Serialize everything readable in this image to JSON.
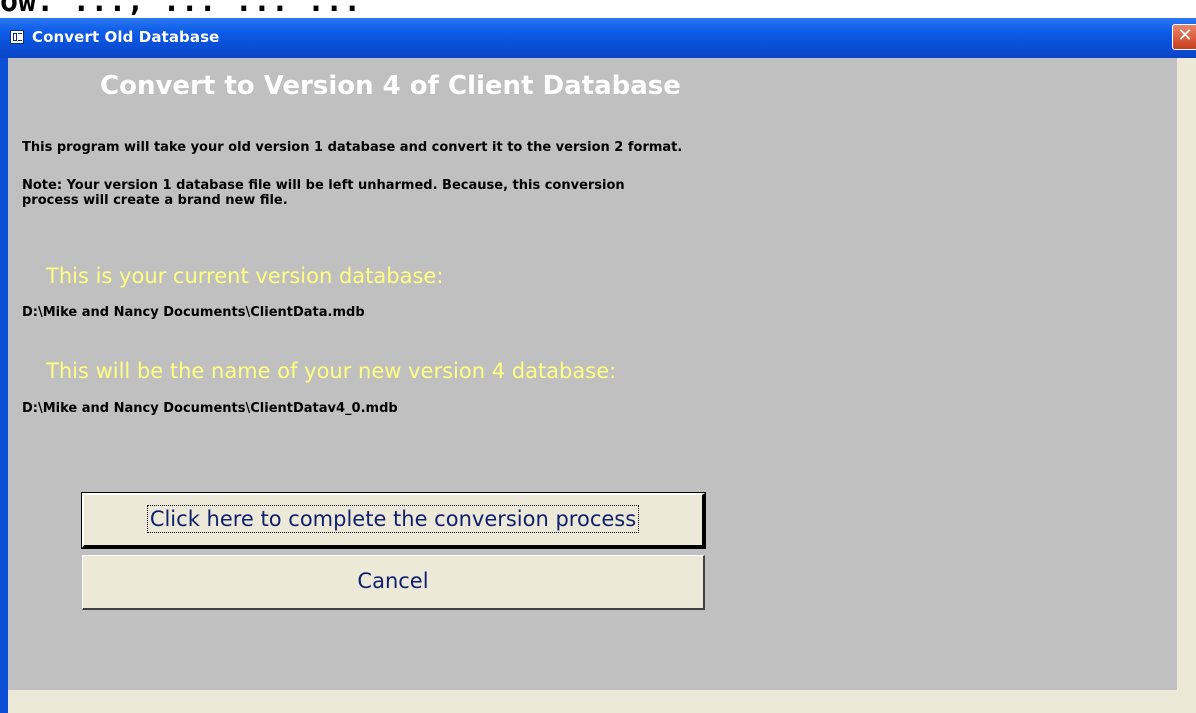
{
  "top_strip_text": "ow.   ...,  ...    ...   ...",
  "window": {
    "title": "Convert Old Database",
    "close_symbol": "✕"
  },
  "form": {
    "heading": "Convert  to Version 4 of Client Database",
    "intro": "This program will take your old version 1 database and convert it to the version 2 format.",
    "note_line1": "Note:  Your version 1 database file will be left unharmed.  Because, this conversion",
    "note_line2": "process will create a brand new file.",
    "current_label": "This is your current version database:",
    "current_path": "D:\\Mike and Nancy Documents\\ClientData.mdb",
    "new_label": "This will be the name of your new version 4 database:",
    "new_path": "D:\\Mike and Nancy Documents\\ClientDatav4_0.mdb",
    "convert_button": "Click here to complete the conversion process",
    "cancel_button": "Cancel"
  },
  "colors": {
    "titlebar": "#0a4fd6",
    "form_background": "#c0c0c0",
    "heading_text": "#ffffff",
    "label_text": "#ffff80",
    "button_face": "#ece9d8",
    "button_text": "#0f1f6e"
  },
  "icons": {
    "window_icon": "form-icon",
    "close": "close-icon"
  }
}
